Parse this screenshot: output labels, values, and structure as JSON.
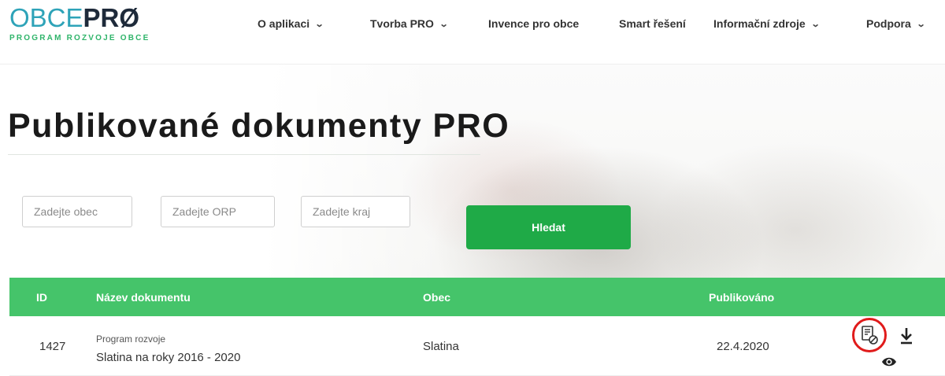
{
  "logo": {
    "brand_part1": "OBCE",
    "brand_part2": "PRØ",
    "tagline": "PROGRAM ROZVOJE OBCE"
  },
  "nav": {
    "items": [
      {
        "label": "O aplikaci",
        "has_dropdown": true
      },
      {
        "label": "Tvorba PRO",
        "has_dropdown": true
      },
      {
        "label": "Invence pro obce",
        "has_dropdown": false
      },
      {
        "label": "Smart řešení",
        "has_dropdown": false
      },
      {
        "label": "Informační zdroje",
        "has_dropdown": true
      },
      {
        "label": "Podpora",
        "has_dropdown": true
      }
    ]
  },
  "page": {
    "title": "Publikované dokumenty PRO"
  },
  "search": {
    "obec_placeholder": "Zadejte obec",
    "orp_placeholder": "Zadejte ORP",
    "kraj_placeholder": "Zadejte kraj",
    "button_label": "Hledat"
  },
  "table": {
    "headers": {
      "id": "ID",
      "name": "Název dokumentu",
      "obec": "Obec",
      "published": "Publikováno"
    },
    "rows": [
      {
        "id": "1427",
        "name_type": "Program rozvoje",
        "name": "Slatina na roky 2016 - 2020",
        "obec": "Slatina",
        "published": "22.4.2020",
        "actions": [
          "unpublish-icon",
          "download-icon",
          "view-icon"
        ]
      }
    ]
  },
  "colors": {
    "accent_green": "#1faa47",
    "table_header_green": "#45c46a",
    "logo_teal": "#2ea3b8",
    "logo_dark": "#1e2a3a",
    "highlight_red": "#e01b1b"
  }
}
